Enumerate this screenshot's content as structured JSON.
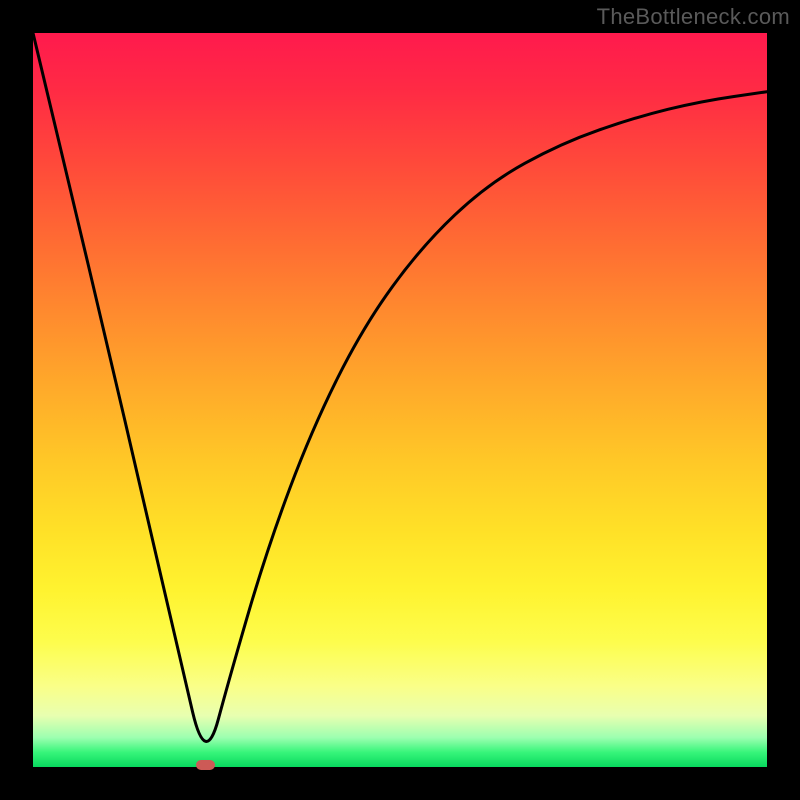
{
  "watermark": "TheBottleneck.com",
  "colors": {
    "frame": "#000000",
    "curve": "#000000",
    "marker": "#cd5a56"
  },
  "chart_data": {
    "type": "line",
    "title": "",
    "xlabel": "",
    "ylabel": "",
    "xlim": [
      0,
      100
    ],
    "ylim": [
      0,
      100
    ],
    "grid": false,
    "series": [
      {
        "name": "bottleneck-curve",
        "x": [
          0,
          5,
          10,
          15,
          20,
          23.5,
          27,
          32,
          38,
          45,
          53,
          62,
          72,
          82,
          91,
          100
        ],
        "y": [
          100,
          79,
          58,
          36.5,
          15,
          0,
          13,
          30,
          46,
          60,
          71,
          79.5,
          85,
          88.5,
          90.7,
          92
        ]
      }
    ],
    "annotations": [
      {
        "name": "min-marker",
        "x": 23.5,
        "y": 0
      }
    ]
  }
}
